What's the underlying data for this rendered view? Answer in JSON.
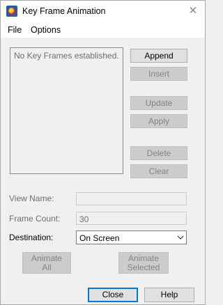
{
  "window": {
    "title": "Key Frame Animation",
    "close_glyph": "✕"
  },
  "menu": {
    "file": "File",
    "options": "Options"
  },
  "keyframes": {
    "empty_text": "No Key Frames established."
  },
  "buttons": {
    "append": "Append",
    "insert": "Insert",
    "update": "Update",
    "apply": "Apply",
    "delete": "Delete",
    "clear": "Clear",
    "animate_all": [
      "Animate",
      "All"
    ],
    "animate_selected": [
      "Animate",
      "Selected"
    ],
    "close": "Close",
    "help": "Help"
  },
  "fields": {
    "view_name_label": "View Name:",
    "view_name_value": "",
    "frame_count_label": "Frame Count:",
    "frame_count_value": "30",
    "destination_label": "Destination:",
    "destination_value": "On Screen"
  },
  "icons": {
    "app": "app-logo-icon",
    "close": "close-icon",
    "dropdown": "chevron-down-icon"
  }
}
